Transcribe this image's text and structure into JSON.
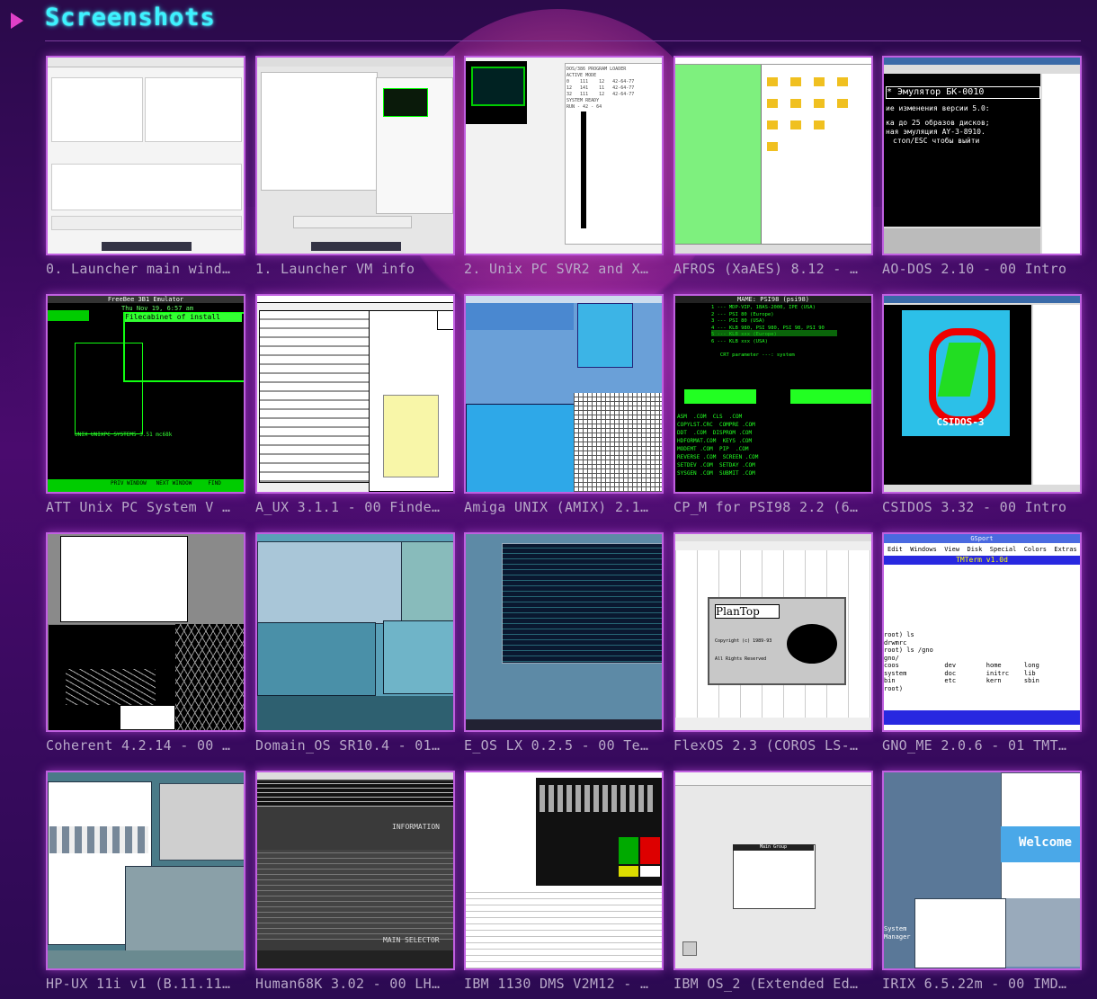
{
  "header": {
    "title": "Screenshots",
    "icon": "play-icon"
  },
  "colors": {
    "title": "#3df2ff",
    "accent": "#e040c8",
    "caption": "#b8a8c8",
    "border": "#c060e0"
  },
  "screenshots": [
    {
      "caption": "0. Launcher main wind…"
    },
    {
      "caption": "1. Launcher VM info"
    },
    {
      "caption": "2. Unix PC SVR2 and X…"
    },
    {
      "caption": "AFROS (XaAES) 8.12 - …"
    },
    {
      "caption": "AO-DOS 2.10 - 00 Intro"
    },
    {
      "caption": "ATT Unix PC System V …"
    },
    {
      "caption": "A_UX 3.1.1 - 00 Finde…"
    },
    {
      "caption": "Amiga UNIX (AMIX) 2.1…"
    },
    {
      "caption": "CP_M for PSI98 2.2 (6…"
    },
    {
      "caption": "CSIDOS 3.32 - 00 Intro"
    },
    {
      "caption": "Coherent 4.2.14 - 00 …"
    },
    {
      "caption": "Domain_OS SR10.4 - 01…"
    },
    {
      "caption": "E_OS LX 0.2.5 - 00 Te…"
    },
    {
      "caption": "FlexOS 2.3 (COROS LS-…"
    },
    {
      "caption": "GNO_ME 2.0.6 - 01 TMT…"
    },
    {
      "caption": "HP-UX 11i v1 (B.11.11…"
    },
    {
      "caption": "Human68K 3.02 - 00 LH…"
    },
    {
      "caption": "IBM 1130 DMS V2M12 - …"
    },
    {
      "caption": "IBM OS_2 (Extended Ed…"
    },
    {
      "caption": "IRIX 6.5.22m - 00 IMD…"
    }
  ],
  "thumb_text": {
    "ao_dos_banner": "* Эмулятор БК-0010",
    "ao_dos_line1": "ие изменения версии 5.0:",
    "ao_dos_line2": "ка до 25 образов дисков;",
    "ao_dos_line3": "ная эмуляция AY-3-8910.",
    "ao_dos_line4": "стоп/ESC чтобы выйти",
    "att_title": "FreeBee 3B1 Emulator",
    "att_menu": "Filecabinet of install",
    "att_date": "Thu Nov 19, 6:57 am",
    "att_ver": "UNIX UNIXPC SYSTEM5 3.51 mc68k",
    "att_keys": "PRIV WINDOW   NEXT WINDOW     FIND",
    "cpm_title": "MAME: PSI98 (psi98)",
    "cpm_lines": "1 --- MDP-VIP, 1BAS-2000, IPE (USA)\n2 --- PSI 80 (Europe)\n3 --- PSI 80 (USA)\n4 --- KLB 980, PSI 980, PSI 98, PSI 90\n5 --- KLB xxx (Europe)\n6 --- KLB xxx (USA)\n\n   CRT parameter ---: system",
    "cpm_files": "ASM  .COM  CLS  .COM\nCOPYLST.CRC  COMPRE .COM\nDDT  .COM  DISPROM .COM\nHDFORMAT.COM  KEYS .COM\nMODEMT .COM  PIP  .COM\nREVERSE .COM  SCREEN .COM\nSETDEV .COM  SETDAY .COM\nSYSGEN .COM  SUBMIT .COM",
    "csidos_logo": "CSIDOS-3",
    "gno_title": "GSport",
    "gno_menu": "Edit  Windows  View  Disk  Special  Colors  Extras",
    "gno_term": "TMTerm v1.0d",
    "gno_lines": "root) ls\ndrwmrc\nroot) ls /gno\ngno/\ncoos            dev        home      long\nsystem          doc        initrc    lib\nbin             etc        kern      sbin\nroot)",
    "flex_logo": "PlanTop",
    "flex_copy": "Copyright (c) 1989-93",
    "flex_rights": "All Rights Reserved",
    "irix_welcome": "Welcome",
    "irix_manager": "System\nManager",
    "human_info": "INFORMATION",
    "human_sel": "MAIN SELECTOR",
    "os2_group": "Main Group"
  }
}
